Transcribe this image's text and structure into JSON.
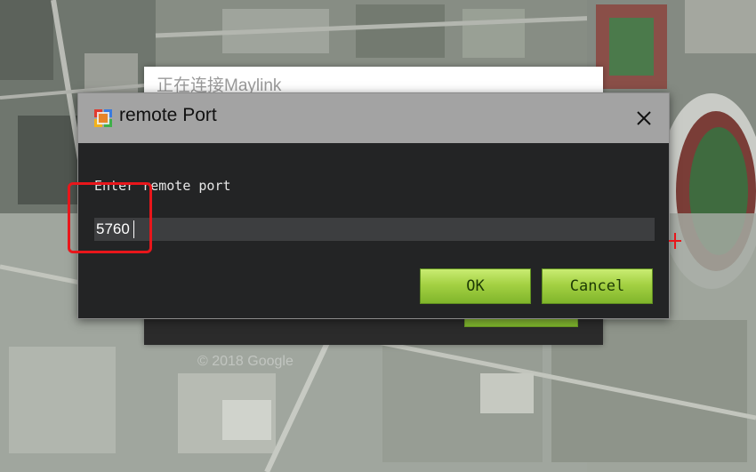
{
  "background_window": {
    "title": "正在连接Maylink"
  },
  "map": {
    "watermark": "© 2018 Google"
  },
  "dialog": {
    "title": "remote Port",
    "icon": "app-window-icon",
    "close_icon": "close-icon",
    "prompt": "Enter remote port",
    "port_value": "5760",
    "ok_label": "OK",
    "cancel_label": "Cancel"
  },
  "colors": {
    "dialog_bg": "#232425",
    "titlebar_bg": "#a3a3a3",
    "input_bg": "#3d3e40",
    "button_green": "#a4d143",
    "highlight_red": "#e8161b"
  }
}
